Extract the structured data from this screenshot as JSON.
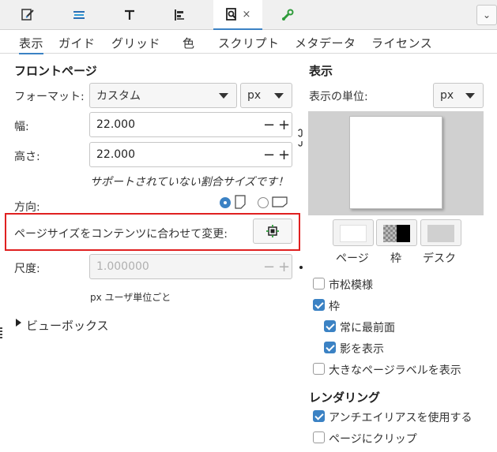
{
  "dock": {
    "tabs": [
      {
        "icon": "fill-stroke-icon"
      },
      {
        "icon": "layers-icon"
      },
      {
        "icon": "text-font-icon"
      },
      {
        "icon": "align-distribute-icon"
      },
      {
        "icon": "document-properties-icon",
        "active": true,
        "close": "×"
      },
      {
        "icon": "preferences-wrench-icon"
      }
    ],
    "overflow": "⌄"
  },
  "tabs": [
    "表示",
    "ガイド",
    "グリッド",
    "色",
    "スクリプト",
    "メタデータ",
    "ライセンス"
  ],
  "front_page": {
    "heading": "フロントページ",
    "format_label": "フォーマット:",
    "format_value": "カスタム",
    "unit_value": "px",
    "width_label": "幅:",
    "width_value": "22.000",
    "height_label": "高さ:",
    "height_value": "22.000",
    "warning": "サポートされていない割合サイズです！",
    "orientation_label": "方向:",
    "fit_label": "ページサイズをコンテンツに合わせて変更:",
    "scale_label": "尺度:",
    "scale_value": "1.000000",
    "scale_hint": "px ユーザ単位ごと",
    "viewbox_label": "ビューボックス",
    "minus": "−",
    "plus": "+"
  },
  "display": {
    "heading": "表示",
    "unit_label": "表示の単位:",
    "unit_value": "px",
    "swatches": [
      "ページ",
      "枠",
      "デスク"
    ],
    "checkerboard": {
      "label": "市松模様",
      "checked": false
    },
    "border": {
      "label": "枠",
      "checked": true
    },
    "always_top": {
      "label": "常に最前面",
      "checked": true
    },
    "show_shadow": {
      "label": "影を表示",
      "checked": true
    },
    "big_label": {
      "label": "大きなページラベルを表示",
      "checked": false
    }
  },
  "rendering": {
    "heading": "レンダリング",
    "antialias": {
      "label": "アンチエイリアスを使用する",
      "checked": true
    },
    "clip": {
      "label": "ページにクリップ",
      "checked": false
    }
  },
  "colors": {
    "accent": "#3b82c4",
    "highlight": "#e02020",
    "desk": "#d0d0d0"
  }
}
